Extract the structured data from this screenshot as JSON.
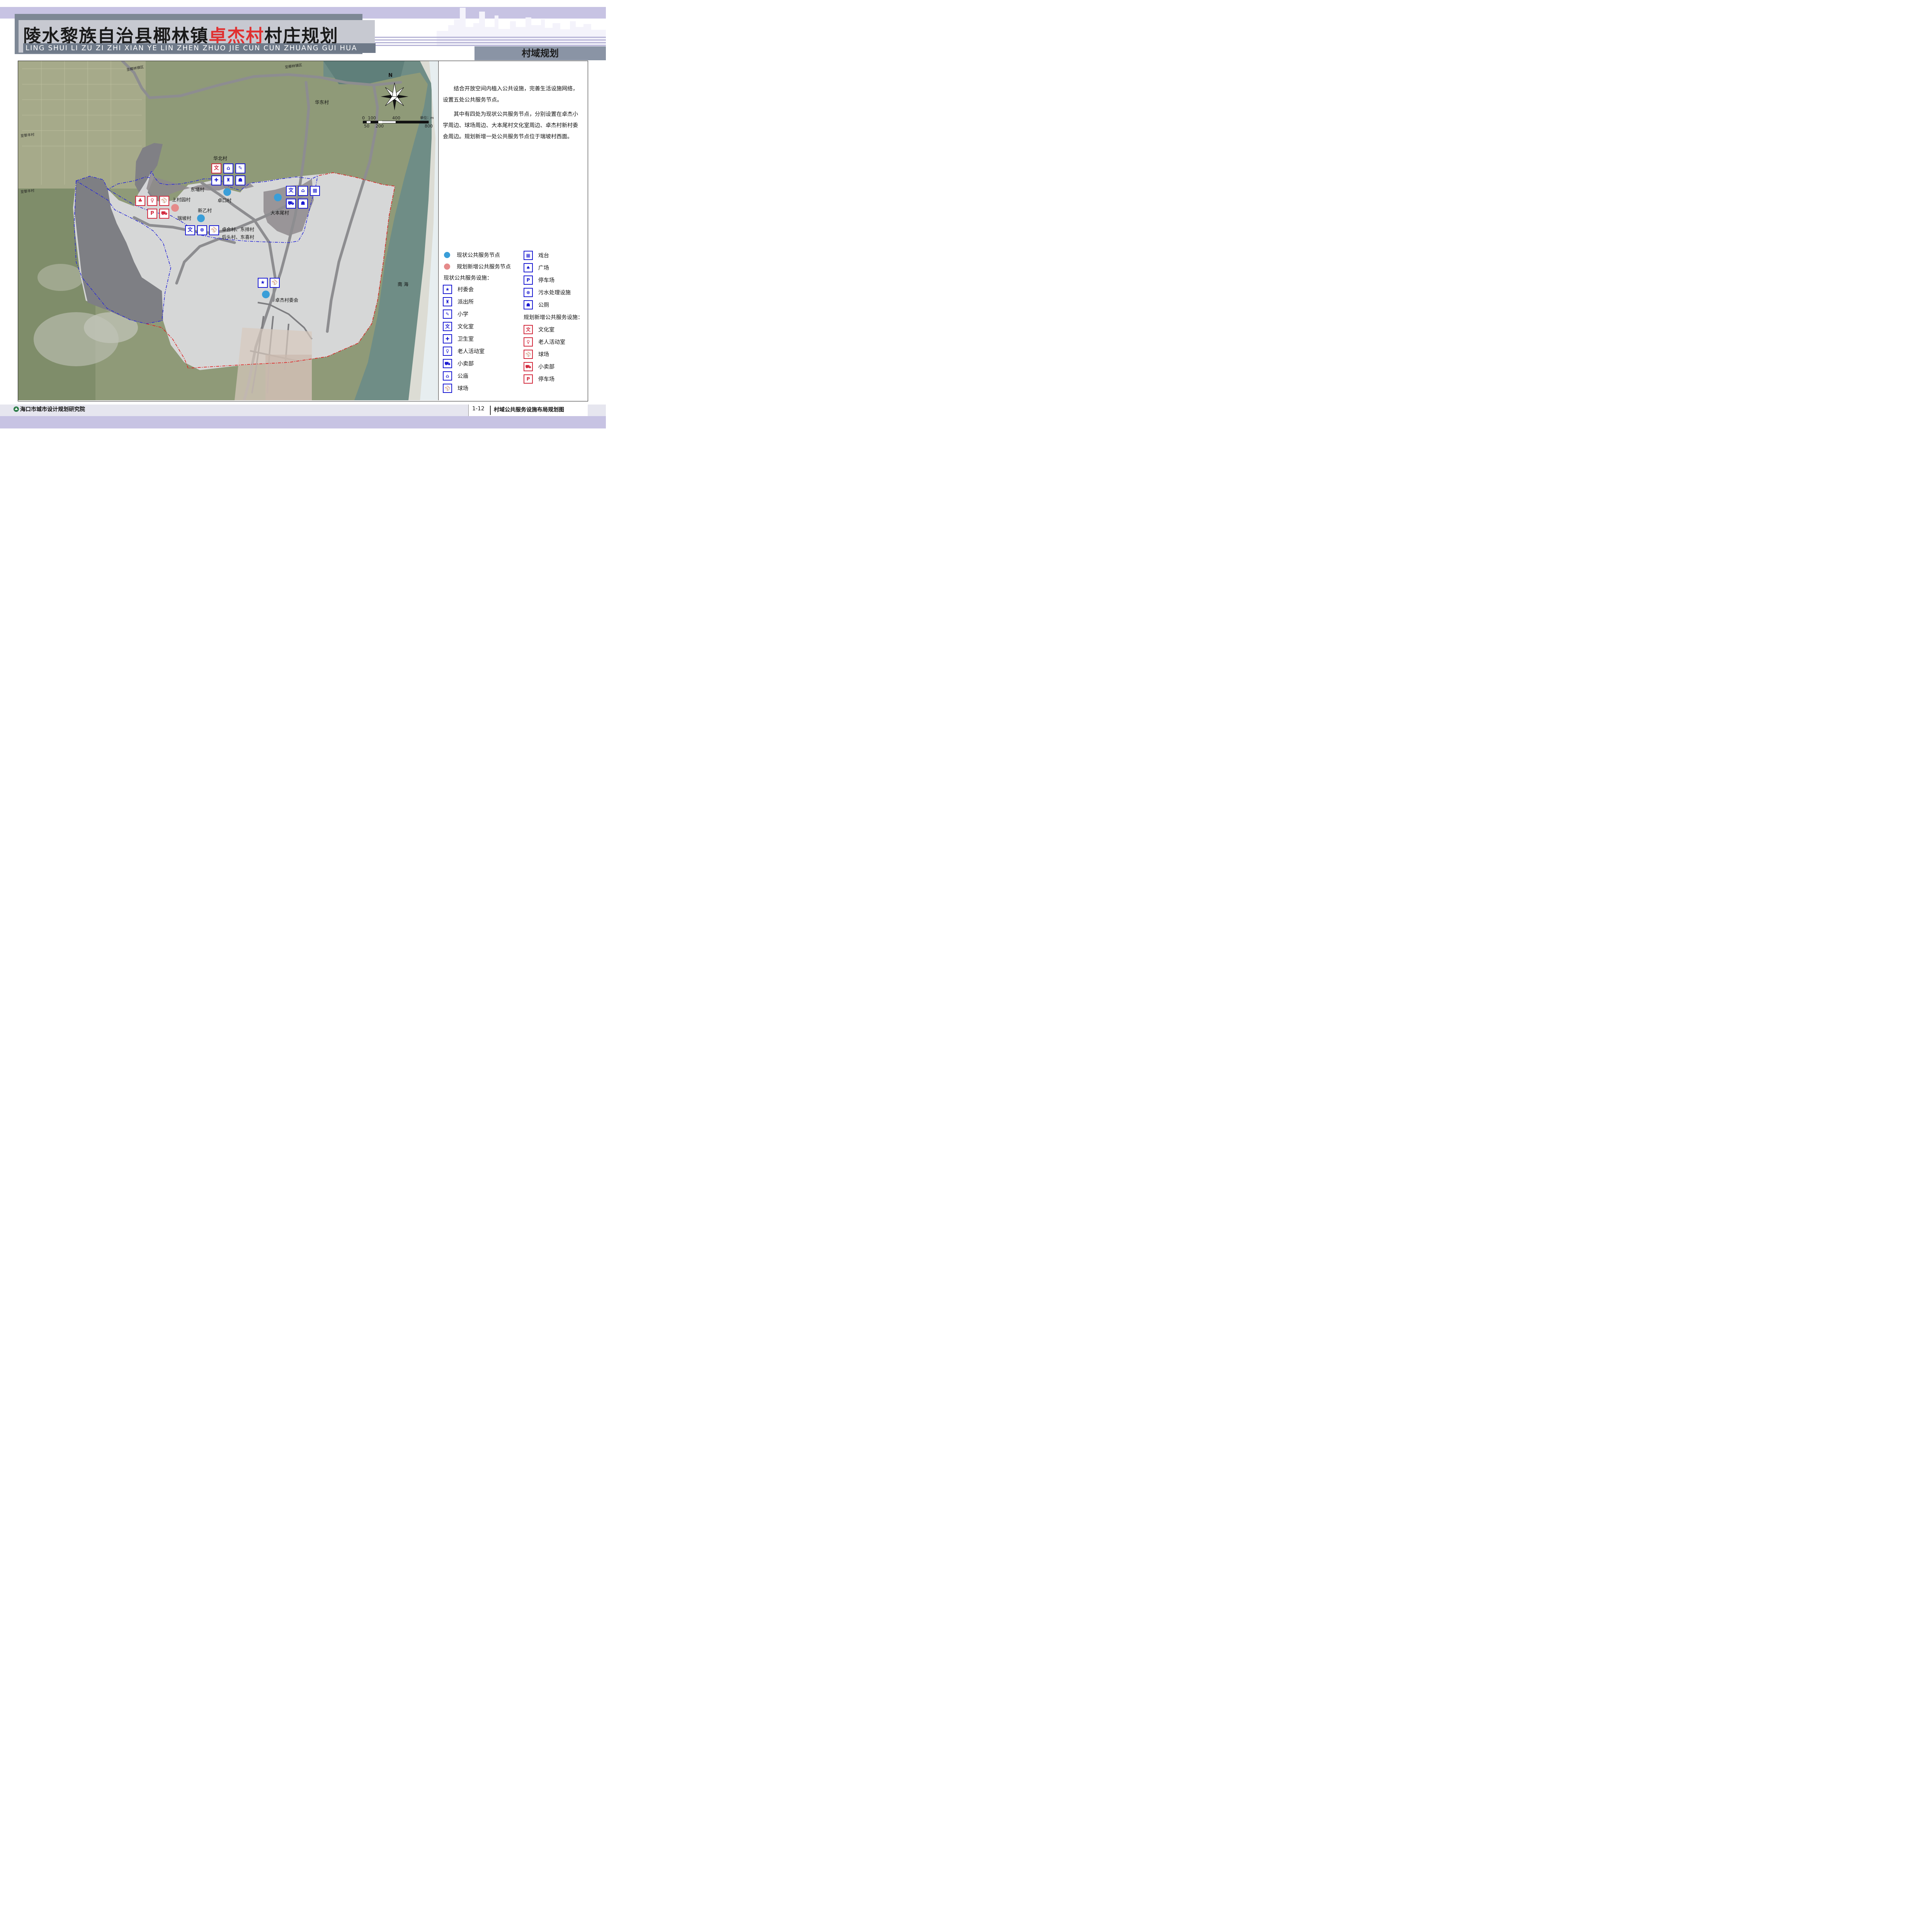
{
  "header": {
    "title_part1": "陵水黎族自治县椰林镇",
    "title_highlight": "卓杰村",
    "title_part2": "村庄规划",
    "title_pinyin": "LING SHUI LI ZU ZI ZHI XIAN YE LIN ZHEN ZHUO JIE CUN CUN ZHUANG GUI HUA",
    "section": "村域规划"
  },
  "description": [
    "结合开放空间内植入公共设施，完善生活设施网络，设置五处公共服务节点。",
    "其中有四处为现状公共服务节点，分别设置在卓杰小学周边、球场周边、大本尾村文化室周边、卓杰村新村委会周边。规划新增一处公共服务节点位于瑞坡村西面。"
  ],
  "map": {
    "north": "N",
    "scale_unit": "单位：m",
    "scale_top": [
      "0",
      "100",
      "400"
    ],
    "scale_bottom": [
      "50",
      "200",
      "800"
    ],
    "road_labels": [
      "至椰林镇区",
      "至椰林镇区",
      "至黎丰村",
      "至黎丰村"
    ],
    "villages": {
      "huadong": "华东村",
      "huabei": "华北村",
      "dongyong": "东埇村",
      "zhuokou": "卓口村",
      "shangcunyuan": "上村园村",
      "xinyi": "新乙村",
      "ruipo": "瑞坡村",
      "dabenwei": "大本尾村",
      "group_line1": "卓合村、东排村",
      "group_line2": "后头村、东喜村",
      "committee": "卓杰村委会",
      "sea": "南 海"
    },
    "icons": {
      "wen": "文",
      "parking": "P"
    }
  },
  "legend": {
    "existing_node": "现状公共服务节点",
    "new_node": "规划新增公共服务节点",
    "existing_heading": "现状公共服务设施：",
    "existing_items": [
      "村委会",
      "派出所",
      "小学",
      "文化室",
      "卫生室",
      "老人活动室",
      "小卖部",
      "公庙",
      "球场"
    ],
    "right_items": [
      "戏台",
      "广场",
      "停车场",
      "污水处理设施",
      "公厕"
    ],
    "new_heading": "规划新增公共服务设施：",
    "new_items": [
      "文化室",
      "老人活动室",
      "球场",
      "小卖部",
      "停车场"
    ]
  },
  "footer": {
    "institute": "海口市城市设计规划研究院",
    "sheet_number": "1-12",
    "sheet_title": "村域公共服务设施布局规划图"
  },
  "colors": {
    "existing_node": "#3a9ed8",
    "new_node": "#e58a8a",
    "icon_blue": "#1a1ad2",
    "icon_red": "#d2283c",
    "boundary_blue": "#2a2ad8",
    "boundary_red": "#e02020",
    "header_band": "#c7c3e3"
  }
}
